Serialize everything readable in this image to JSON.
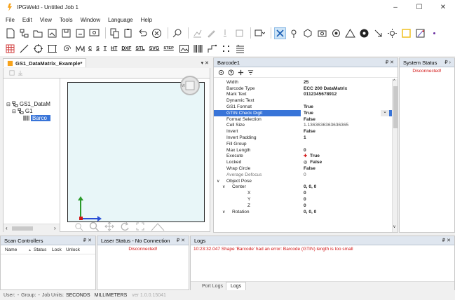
{
  "window": {
    "title": "IPGWeld - Untitled Job 1",
    "min": "–",
    "max": "☐",
    "close": "✕"
  },
  "menu": [
    "File",
    "Edit",
    "View",
    "Tools",
    "Window",
    "Language",
    "Help"
  ],
  "toolbar2_text": [
    "C",
    "S",
    "T",
    "HT",
    "DXF",
    "STL",
    "SVG",
    "STEP"
  ],
  "document": {
    "tab_label": "GS1_DataMatrix_Example*",
    "tab_close": "▾ ✕",
    "tree": {
      "root": "GS1_DataM",
      "group": "G1",
      "item": "Barco"
    }
  },
  "barcode_panel": {
    "title": "Barcode1",
    "controls": "₽ ✕",
    "properties": [
      {
        "key": "Width",
        "value": "25",
        "style": "bold"
      },
      {
        "key": "Barcode Type",
        "value": "ECC 200 DataMatrix",
        "style": "bold"
      },
      {
        "key": "Mark Text",
        "value": "0112345678912",
        "style": "bold"
      },
      {
        "key": "Dynamic Text",
        "value": "",
        "style": ""
      },
      {
        "key": "GS1 Format",
        "value": "True",
        "style": "bold"
      },
      {
        "key": "GTIN Check Digit",
        "value": "True",
        "style": "bold",
        "selected": true
      },
      {
        "key": "Format Selection",
        "value": "False",
        "style": "bold"
      },
      {
        "key": "Cell Size",
        "value": "1.1363636363636365",
        "style": "grey"
      },
      {
        "key": "Invert",
        "value": "False",
        "style": "bold"
      },
      {
        "key": "Invert Padding",
        "value": "1",
        "style": "bold"
      },
      {
        "key": "Fill Group",
        "value": "",
        "style": ""
      },
      {
        "key": "Max Length",
        "value": "0",
        "style": "bold"
      },
      {
        "key": "Execute",
        "value": "True",
        "style": "bold",
        "icon": "execute"
      },
      {
        "key": "Locked",
        "value": "False",
        "style": "bold",
        "icon": "lock"
      },
      {
        "key": "Wrap Circle",
        "value": "False",
        "style": "bold"
      },
      {
        "key": "Average Defocus",
        "value": "0",
        "style": "grey",
        "keystyle": "grey"
      },
      {
        "key": "Object Pose",
        "value": "",
        "style": "",
        "expander": "∨",
        "indent": 0
      },
      {
        "key": "Center",
        "value": "0, 0, 0",
        "style": "bold",
        "expander": "∨",
        "indent": 1
      },
      {
        "key": "X",
        "value": "0",
        "style": "bold",
        "indent": 2
      },
      {
        "key": "Y",
        "value": "0",
        "style": "bold",
        "indent": 2
      },
      {
        "key": "Z",
        "value": "0",
        "style": "bold",
        "indent": 2
      },
      {
        "key": "Rotation",
        "value": "0, 0, 0",
        "style": "bold",
        "expander": "∨",
        "indent": 1
      }
    ]
  },
  "system_status": {
    "title": "System Status",
    "controls": "₽ ›",
    "message": "Disconnected!"
  },
  "scan_controllers": {
    "title": "Scan Controllers",
    "controls": "₽ ✕",
    "columns": [
      "Name",
      "Status",
      "Lock",
      "Unlock"
    ]
  },
  "laser_status": {
    "title": "Laser Status - No Connection",
    "controls": "₽ ✕",
    "message": "Disconnected!"
  },
  "logs": {
    "title": "Logs",
    "controls": "₽ ✕",
    "entries": [
      "10:23:32.047 Shape 'Barcode' had an error: Barcode (GTIN) length is too small"
    ],
    "tabs": [
      "Port Logs",
      "Logs"
    ]
  },
  "statusbar": {
    "user_label": "User:",
    "user_value": "-",
    "group_label": "Group:",
    "group_value": "-",
    "units_label": "Job Units:",
    "time_unit": "SECONDS",
    "length_unit": "MILLIMETERS",
    "version": "ver 1.0.0.15041"
  },
  "colors": {
    "accent": "#3874d8",
    "error": "#d21414",
    "panel_header": "#dfe6ef",
    "canvas": "#e8f6f8"
  }
}
